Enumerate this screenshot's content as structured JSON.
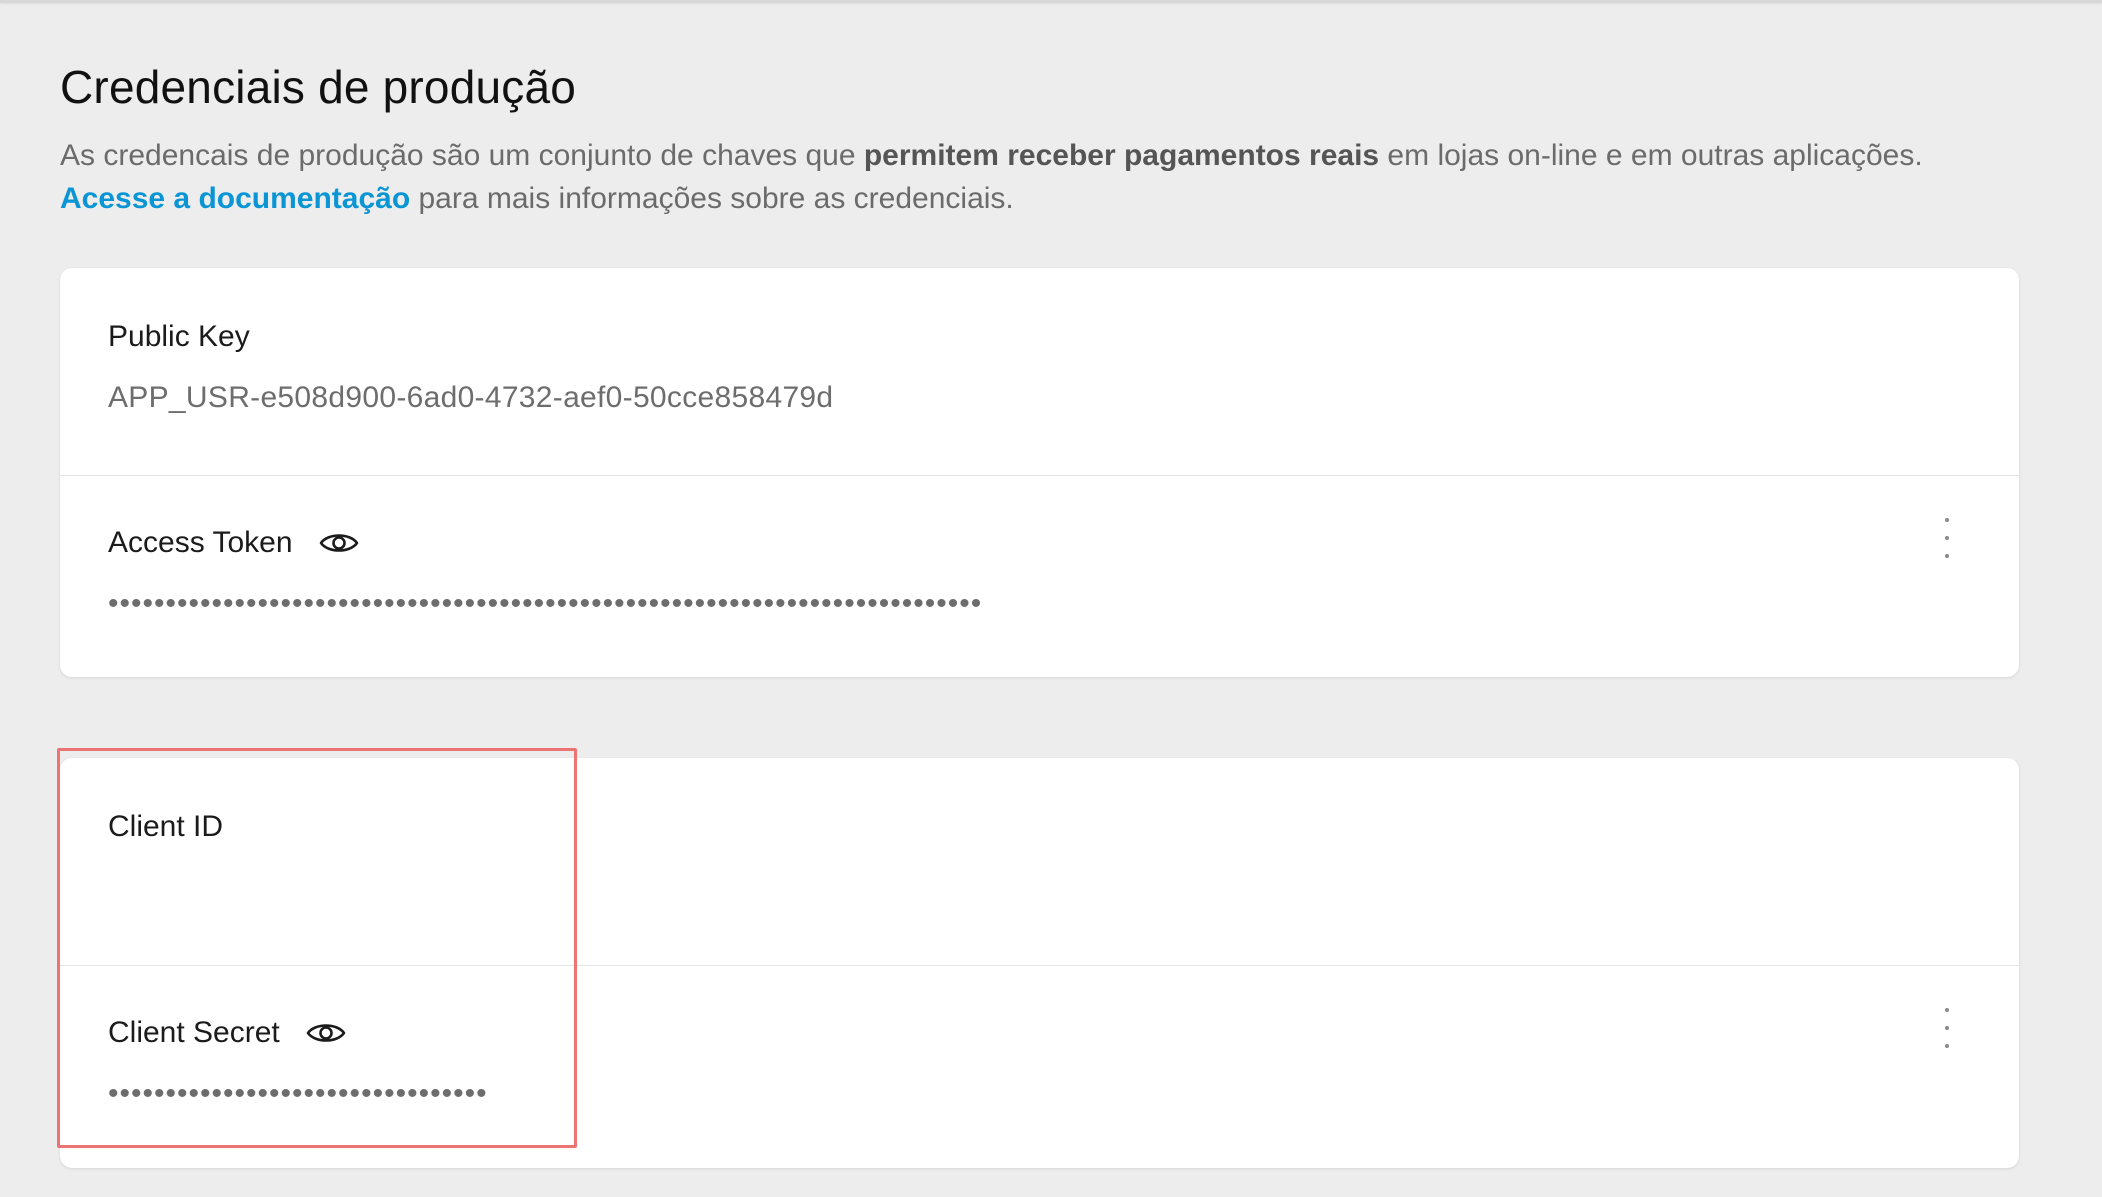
{
  "page": {
    "title": "Credenciais de produção",
    "intro_part1": "As credencais de produção são um conjunto de chaves que ",
    "intro_bold": "permitem receber pagamentos reais",
    "intro_part2": " em lojas on-line e em outras aplicações.",
    "doc_link": "Acesse a documentação",
    "intro_part3": " para mais informações sobre as credenciais."
  },
  "card_keys": {
    "public_key": {
      "label": "Public Key",
      "value": "APP_USR-e508d900-6ad0-4732-aef0-50cce858479d"
    },
    "access_token": {
      "label": "Access Token",
      "masked_value": "••••••••••••••••••••••••••••••••••••••••••••••••••••••••••••••••••••••••••••",
      "icon": "eye-icon",
      "menu_icon": "more-vertical-icon"
    }
  },
  "card_client": {
    "client_id": {
      "label": "Client ID",
      "value": ""
    },
    "client_secret": {
      "label": "Client Secret",
      "masked_value": "•••••••••••••••••••••••••••••••••",
      "icon": "eye-icon",
      "menu_icon": "more-vertical-icon"
    }
  },
  "colors": {
    "background": "#ededed",
    "link": "#0a95d4",
    "highlight_border": "#ec7474",
    "card": "#ffffff"
  }
}
